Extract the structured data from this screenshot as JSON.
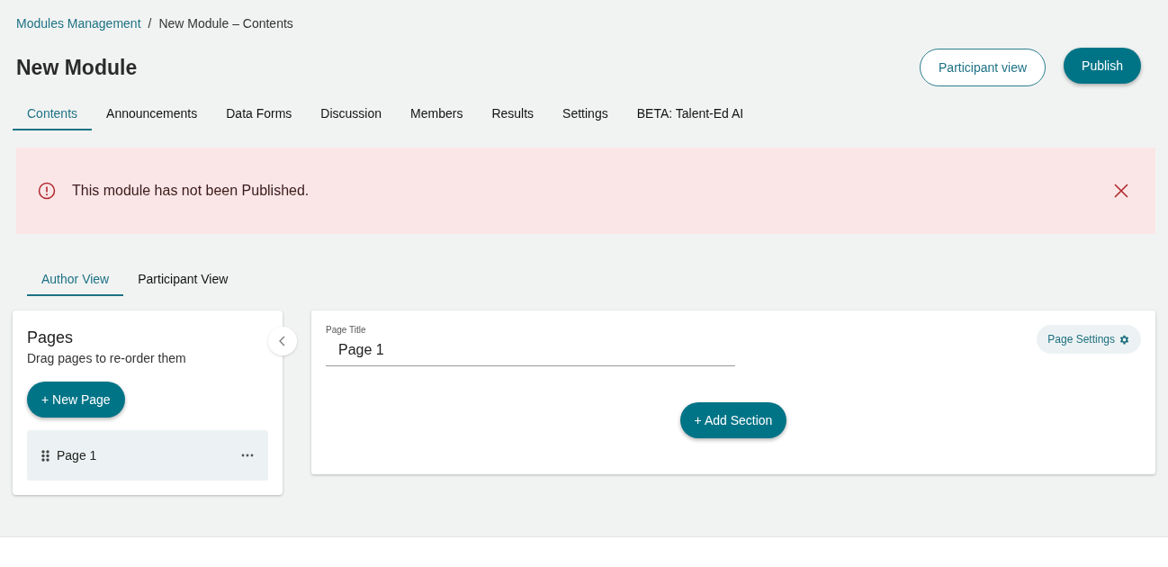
{
  "breadcrumb": {
    "link": "Modules Management",
    "separator": "/",
    "current": "New Module – Contents"
  },
  "title": "New Module",
  "header_buttons": [
    {
      "label": "Participant view",
      "kind": "outline"
    },
    {
      "label": "Publish",
      "kind": "filled"
    }
  ],
  "tabs": [
    {
      "label": "Contents",
      "selected": true
    },
    {
      "label": "Announcements",
      "selected": false
    },
    {
      "label": "Data Forms",
      "selected": false
    },
    {
      "label": "Discussion",
      "selected": false
    },
    {
      "label": "Members",
      "selected": false
    },
    {
      "label": "Results",
      "selected": false
    },
    {
      "label": "Settings",
      "selected": false
    },
    {
      "label": "BETA: Talent-Ed AI",
      "selected": false
    }
  ],
  "alert": {
    "message": "This module has not been Published."
  },
  "view_tabs": [
    {
      "label": "Author View",
      "selected": true
    },
    {
      "label": "Participant View",
      "selected": false
    }
  ],
  "pages_panel": {
    "title": "Pages",
    "subtitle": "Drag pages to re-order them",
    "new_page_button": "+ New Page",
    "pages": [
      {
        "label": "Page 1",
        "selected": true
      }
    ]
  },
  "editor": {
    "field_label": "Page Title",
    "field_value": "Page 1",
    "settings_button": "Page Settings",
    "add_section_button": "+ Add Section"
  }
}
